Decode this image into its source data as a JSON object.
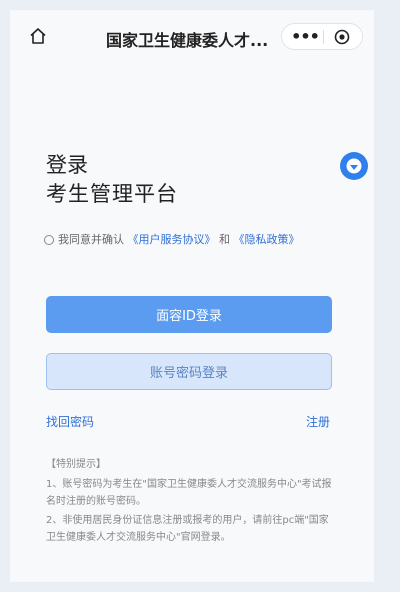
{
  "topbar": {
    "title": "国家卫生健康委人才...",
    "more_label": "•••"
  },
  "heading": {
    "login": "登录",
    "platform": "考生管理平台"
  },
  "agreement": {
    "prefix": "我同意并确认",
    "user_agreement": "《用户服务协议》",
    "and": "和",
    "privacy_policy": "《隐私政策》"
  },
  "buttons": {
    "face_login": "面容ID登录",
    "password_login": "账号密码登录"
  },
  "links": {
    "forgot_password": "找回密码",
    "register": "注册"
  },
  "tips": {
    "title": "【特别提示】",
    "items": [
      "1、账号密码为考生在\"国家卫生健康委人才交流服务中心\"考试报名时注册的账号密码。",
      "2、非使用居民身份证信息注册或报考的用户，请前往pc端\"国家卫生健康委人才交流服务中心\"官网登录。"
    ]
  },
  "icons": {
    "home": "home-icon",
    "more": "more-icon",
    "target": "target-icon",
    "float": "chat-icon"
  },
  "colors": {
    "primary": "#5b9bf0",
    "secondary_bg": "#d8e6fb",
    "link": "#2f6fd8"
  }
}
